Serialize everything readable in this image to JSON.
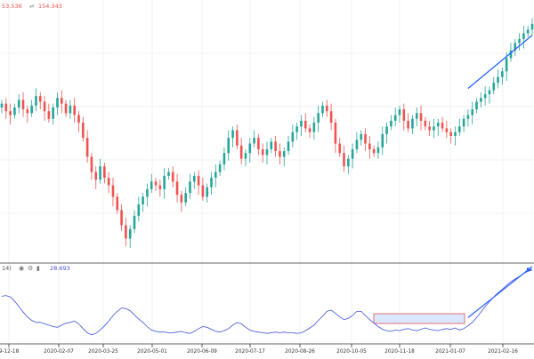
{
  "header": {
    "prefix": "53.536",
    "value": "154.343"
  },
  "indicator": {
    "period_label": "14)",
    "value": "28.693"
  },
  "x_axis": {
    "ticks": [
      "9-12-18",
      "2020-02-07",
      "2020-03-25",
      "2020-05-01",
      "2020-06-09",
      "2020-07-17",
      "2020-08-26",
      "2020-10-05",
      "2020-11-18",
      "2021-01-07",
      "2021-02-16"
    ]
  },
  "colors": {
    "up": "#26a69a",
    "down": "#ef5350",
    "indicator_line": "#3f51d8",
    "trendline": "#2962ff",
    "highlight_fill": "#dbe6ff",
    "highlight_border": "#e57373",
    "grid": "#f0f0f0"
  },
  "chart_data": [
    {
      "type": "candlestick",
      "series": [
        {
          "name": "",
          "close": [
            122,
            118,
            116,
            120,
            124,
            119,
            117,
            121,
            126,
            123,
            118,
            114,
            120,
            125,
            122,
            117,
            121,
            116,
            112,
            104,
            94,
            86,
            82,
            89,
            83,
            79,
            73,
            66,
            58,
            51,
            56,
            63,
            69,
            73,
            77,
            81,
            79,
            77,
            84,
            86,
            81,
            74,
            70,
            75,
            81,
            84,
            79,
            73,
            78,
            83,
            86,
            90,
            96,
            104,
            108,
            100,
            93,
            96,
            101,
            104,
            98,
            95,
            98,
            102,
            97,
            94,
            97,
            102,
            107,
            110,
            113,
            109,
            107,
            112,
            117,
            121,
            118,
            112,
            101,
            96,
            89,
            93,
            98,
            103,
            106,
            101,
            98,
            96,
            99,
            106,
            110,
            113,
            116,
            119,
            113,
            109,
            114,
            117,
            113,
            110,
            108,
            110,
            112,
            109,
            107,
            105,
            107,
            110,
            114,
            116,
            119,
            123,
            125,
            127,
            129,
            133,
            136,
            139,
            146,
            150,
            154,
            156,
            159,
            161,
            164
          ],
          "ylim": [
            40,
            170
          ]
        }
      ],
      "trendline": {
        "from": [
          109,
          130
        ],
        "to": [
          124,
          158
        ]
      }
    },
    {
      "type": "line",
      "series": [
        {
          "name": "",
          "values": [
            59,
            60,
            58,
            52,
            44,
            36,
            29,
            24,
            21,
            21,
            19,
            17,
            15,
            14,
            17,
            20,
            21,
            23,
            19,
            12,
            6,
            3,
            5,
            10,
            16,
            23,
            31,
            37,
            42,
            41,
            38,
            32,
            26,
            21,
            15,
            10,
            8,
            7,
            7,
            6,
            6,
            7,
            8,
            6,
            5,
            8,
            12,
            15,
            14,
            11,
            8,
            7,
            9,
            12,
            17,
            21,
            19,
            14,
            10,
            8,
            7,
            6,
            5,
            6,
            7,
            6,
            7,
            6,
            6,
            5,
            6,
            9,
            13,
            17,
            24,
            30,
            37,
            39,
            34,
            29,
            25,
            27,
            31,
            37,
            37,
            31,
            25,
            20,
            15,
            11,
            9,
            8,
            10,
            9,
            11,
            12,
            10,
            9,
            11,
            13,
            11,
            10,
            9,
            11,
            12,
            11,
            13,
            10,
            12,
            16,
            21,
            28,
            36,
            44,
            51,
            58,
            64,
            69,
            75,
            80,
            84,
            88,
            92,
            95,
            97
          ],
          "ylim": [
            -5,
            102
          ]
        }
      ],
      "trendline": {
        "from": [
          109,
          28
        ],
        "to": [
          124,
          102
        ]
      }
    }
  ]
}
